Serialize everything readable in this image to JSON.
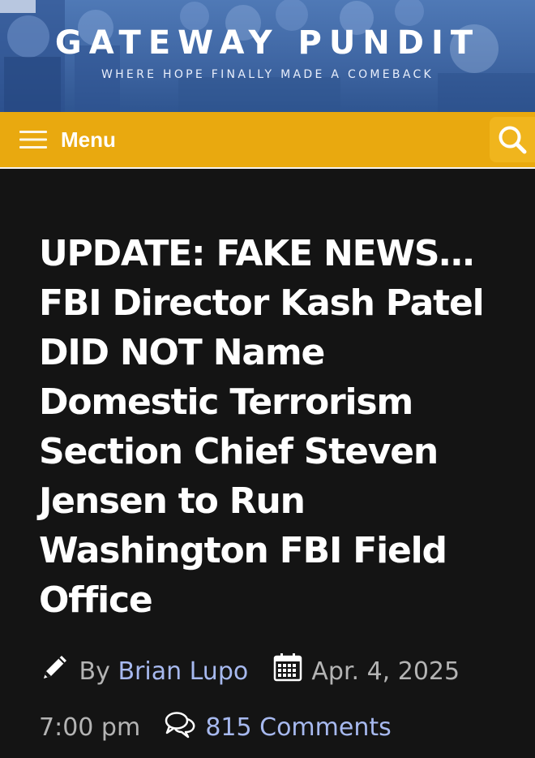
{
  "header": {
    "site_title": "GATEWAY PUNDIT",
    "tagline": "WHERE HOPE FINALLY MADE A COMEBACK",
    "background_color": "#3f66a3"
  },
  "nav": {
    "menu_label": "Menu",
    "menu_icon": "hamburger-icon",
    "search_icon": "search-icon",
    "bar_color": "#e9a90f"
  },
  "article": {
    "headline": "UPDATE: FAKE NEWS… FBI Director Kash Patel DID NOT Name Domestic Terrorism Section Chief Steven Jensen to Run Washington FBI Field Office",
    "byline_prefix": "By",
    "author": "Brian Lupo",
    "date": "Apr. 4, 2025",
    "time": "7:00 pm",
    "comments": "815 Comments",
    "link_color": "#a7b9ef"
  }
}
